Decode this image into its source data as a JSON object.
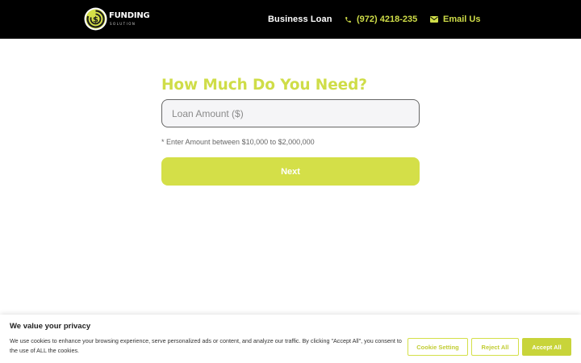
{
  "header": {
    "logo": {
      "name": "FUNDING",
      "tagline": "SOLUTION"
    },
    "nav": {
      "business_loan": "Business Loan",
      "phone": "(972) 4218-235",
      "email": "Email Us"
    }
  },
  "form": {
    "title": "How Much Do You Need?",
    "amount_placeholder": "Loan Amount ($)",
    "amount_value": "",
    "hint": "* Enter Amount between $10,000 to $2,000,000",
    "next_label": "Next"
  },
  "cookie": {
    "title": "We value your privacy",
    "text": "We use cookies to enhance your browsing experience, serve personalized ads or content, and analyze our traffic. By clicking \"Accept All\", you consent to the use of ALL the cookies.",
    "settings_label": "Cookie Setting",
    "reject_label": "Reject All",
    "accept_label": "Accept All"
  },
  "icons": {
    "logo": "dollar-swirl-logo-icon",
    "phone": "phone-icon",
    "email": "envelope-icon"
  },
  "colors": {
    "accent": "#cfdd48",
    "header_bg": "#000000",
    "button_bg": "#d4df48",
    "accept_bg": "#c8d43a"
  }
}
